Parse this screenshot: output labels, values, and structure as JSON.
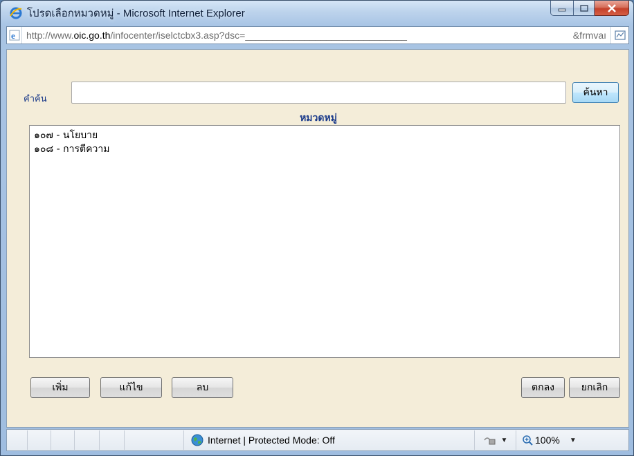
{
  "window": {
    "title": "โปรดเลือกหมวดหมู่ - Microsoft Internet Explorer",
    "icon": "ie-logo-icon"
  },
  "address": {
    "url_prefix": "http://www.",
    "url_domain": "oic.go.th",
    "url_path": "/infocenter/iselctcbx3.asp?dsc=______________________________",
    "url_tail": "&frmvaı"
  },
  "form": {
    "search_label": "คำค้น",
    "search_value": "",
    "search_button": "ค้นหา",
    "list_header": "หมวดหมู่",
    "items": [
      "๑๐๗ - นโยบาย",
      "๑๐๘ - การตีความ"
    ],
    "buttons": {
      "add": "เพิ่ม",
      "edit": "แก้ไข",
      "delete": "ลบ",
      "ok": "ตกลง",
      "cancel": "ยกเลิก"
    }
  },
  "status": {
    "zone_text": "Internet | Protected Mode: Off",
    "zoom": "100%"
  },
  "colors": {
    "content_bg": "#f4edd9",
    "label_blue": "#1a3a8a"
  }
}
